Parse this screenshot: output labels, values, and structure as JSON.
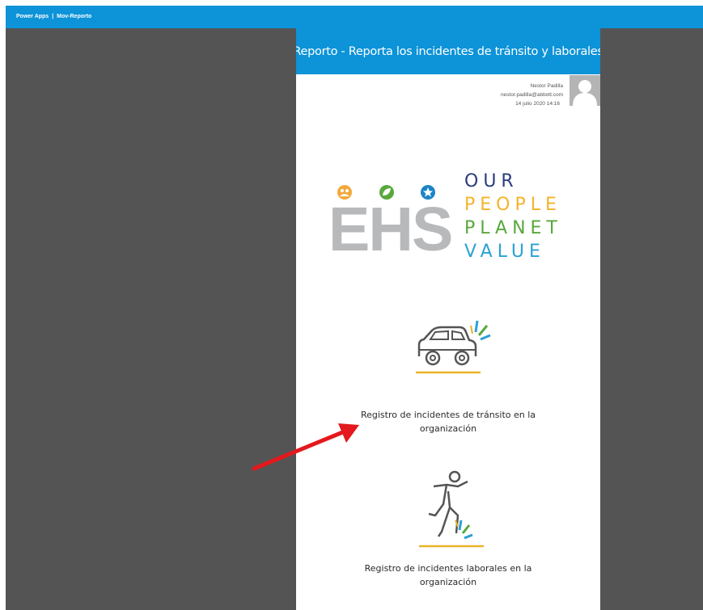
{
  "top_bar": {
    "app_name": "Power Apps",
    "separator": "|",
    "app_title": "Mov-Reporto"
  },
  "app": {
    "header_title": "Reporto - Reporta los incidentes de tránsito y laborales",
    "user": {
      "name": "Nestor Padilla",
      "email": "nestor.padilla@abbott.com",
      "datetime": "14 julio 2020 14:16"
    },
    "logo": {
      "brand": "EHS",
      "words": [
        "OUR",
        "PEOPLE",
        "PLANET",
        "VALUE"
      ]
    },
    "tiles": [
      {
        "icon": "car-accident-icon",
        "label_line1": "Registro de incidentes de tránsito en la",
        "label_line2": "organización"
      },
      {
        "icon": "person-fall-icon",
        "label_line1": "Registro de incidentes laborales en la",
        "label_line2": "organización"
      }
    ]
  },
  "colors": {
    "header_blue": "#0c93d8",
    "backdrop_gray": "#545454",
    "annotation_red": "#e3191d",
    "accent_yellow": "#e9b429",
    "accent_green": "#58a83d",
    "accent_blue": "#2ba1d3",
    "dark_blue": "#2b3c7d"
  }
}
